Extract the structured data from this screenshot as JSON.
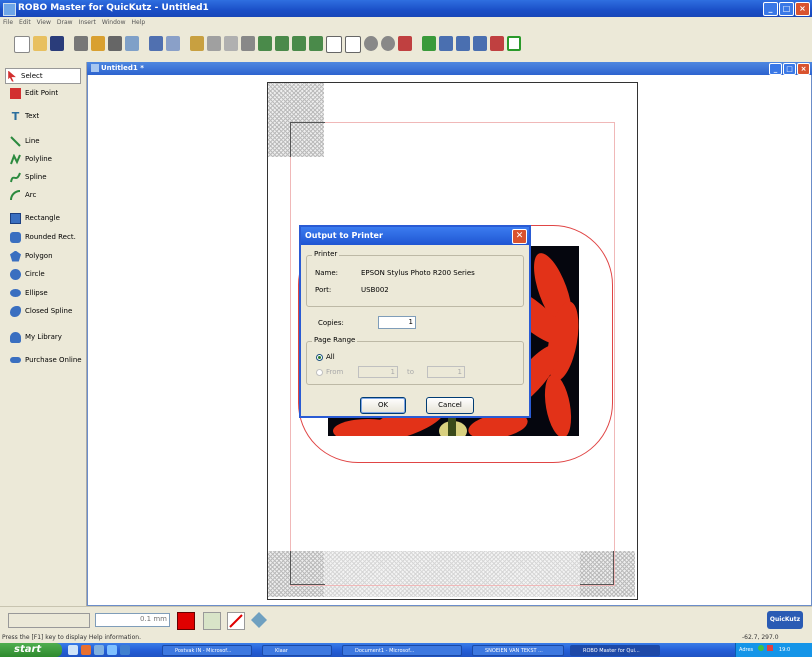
{
  "window": {
    "title": "ROBO Master for QuicKutz - Untitled1"
  },
  "menu": [
    "File",
    "Edit",
    "View",
    "Draw",
    "Insert",
    "Window",
    "Help"
  ],
  "document": {
    "title": "Untitled1 *"
  },
  "tools": [
    {
      "label": "Select",
      "icon": "select-arrow-icon",
      "color": "#d23030"
    },
    {
      "label": "Edit Point",
      "icon": "edit-point-icon",
      "color": "#d23030"
    },
    {
      "label": "Text",
      "icon": "text-icon",
      "color": "#2b6f9e"
    },
    {
      "label": "Line",
      "icon": "line-icon",
      "color": "#2b8a3e"
    },
    {
      "label": "Polyline",
      "icon": "polyline-icon",
      "color": "#2b8a3e"
    },
    {
      "label": "Spline",
      "icon": "spline-icon",
      "color": "#2b8a3e"
    },
    {
      "label": "Arc",
      "icon": "arc-icon",
      "color": "#2b8a3e"
    },
    {
      "label": "Rectangle",
      "icon": "rectangle-icon",
      "color": "#3a6fc0"
    },
    {
      "label": "Rounded Rect.",
      "icon": "rounded-rect-icon",
      "color": "#3a6fc0"
    },
    {
      "label": "Polygon",
      "icon": "polygon-icon",
      "color": "#3a6fc0"
    },
    {
      "label": "Circle",
      "icon": "circle-icon",
      "color": "#3a6fc0"
    },
    {
      "label": "Ellipse",
      "icon": "ellipse-icon",
      "color": "#3a6fc0"
    },
    {
      "label": "Closed Spline",
      "icon": "closed-spline-icon",
      "color": "#3a6fc0"
    },
    {
      "label": "My Library",
      "icon": "library-icon",
      "color": "#3a6fc0"
    },
    {
      "label": "Purchase Online",
      "icon": "purchase-icon",
      "color": "#3a6fc0"
    }
  ],
  "dialog": {
    "title": "Output to Printer",
    "printer_group": "Printer",
    "name_label": "Name:",
    "name_value": "EPSON Stylus Photo R200 Series",
    "port_label": "Port:",
    "port_value": "USB002",
    "copies_label": "Copies:",
    "copies_value": "1",
    "range_group": "Page Range",
    "all_label": "All",
    "from_label": "From",
    "from_value": "1",
    "to_label": "to",
    "to_value": "1",
    "ok": "OK",
    "cancel": "Cancel"
  },
  "bottom": {
    "line_width": "0.1 mm",
    "fill_color": "#e00000",
    "logo": "QuicKutz"
  },
  "status": {
    "help": "Press the [F1] key to display Help information.",
    "coords": "-62.7, 297.0"
  },
  "taskbar": {
    "start": "start",
    "tasks": [
      "Postvak IN - Microsof...",
      "Klaar",
      "Document1 - Microsof...",
      "SNOEIEN VAN TEKST ...",
      "ROBO Master for Qui..."
    ],
    "tray_text": "Adres",
    "clock": "19:0"
  }
}
